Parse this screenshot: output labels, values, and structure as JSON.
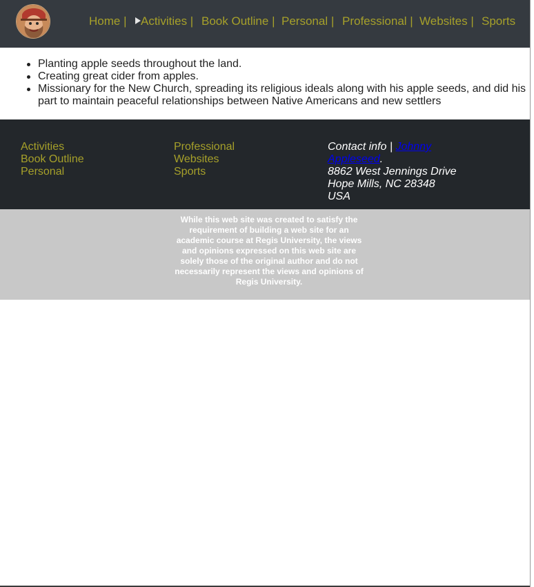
{
  "header": {
    "logo_label": "Johnny Appleseed portrait",
    "nav": [
      {
        "label": "Home",
        "sep": " |"
      },
      {
        "label": "Activities",
        "sep": " |",
        "current": true
      },
      {
        "label": "Book Outline",
        "sep": " |"
      },
      {
        "label": "Personal",
        "sep": " |"
      },
      {
        "label": "Professional",
        "sep": " |"
      },
      {
        "label": "Websites",
        "sep": " |"
      },
      {
        "label": "Sports",
        "sep": ""
      }
    ]
  },
  "content": {
    "items": [
      "Planting apple seeds throughout the land.",
      "Creating great cider from apples.",
      "Missionary for the New Church, spreading its religious ideals along with his apple seeds, and did his part to maintain peaceful relationships between Native Americans and new settlers"
    ]
  },
  "footer": {
    "col1": [
      "Activities",
      "Book Outline",
      "Personal"
    ],
    "col2": [
      "Professional",
      "Websites",
      "Sports"
    ],
    "contact_prefix": "Contact info | ",
    "contact_link": "Johnny Appleseed",
    "contact_suffix": ".",
    "address_line1": "8862 West Jennings Drive",
    "address_line2": "Hope Mills, NC 28348",
    "address_line3": "USA"
  },
  "disclaimer": "While this web site was created to satisfy the requirement of building a web site for an academic course at Regis University, the views and opinions expressed on this web site are solely those of the original author and do not necessarily represent the views and opinions of Regis University.",
  "colors": {
    "header_bg": "#353a40",
    "footer_bg": "#23272b",
    "nav_link": "#a6a02a",
    "disclaimer_bg": "#c8c8c8",
    "contact_link": "#0000ee"
  }
}
